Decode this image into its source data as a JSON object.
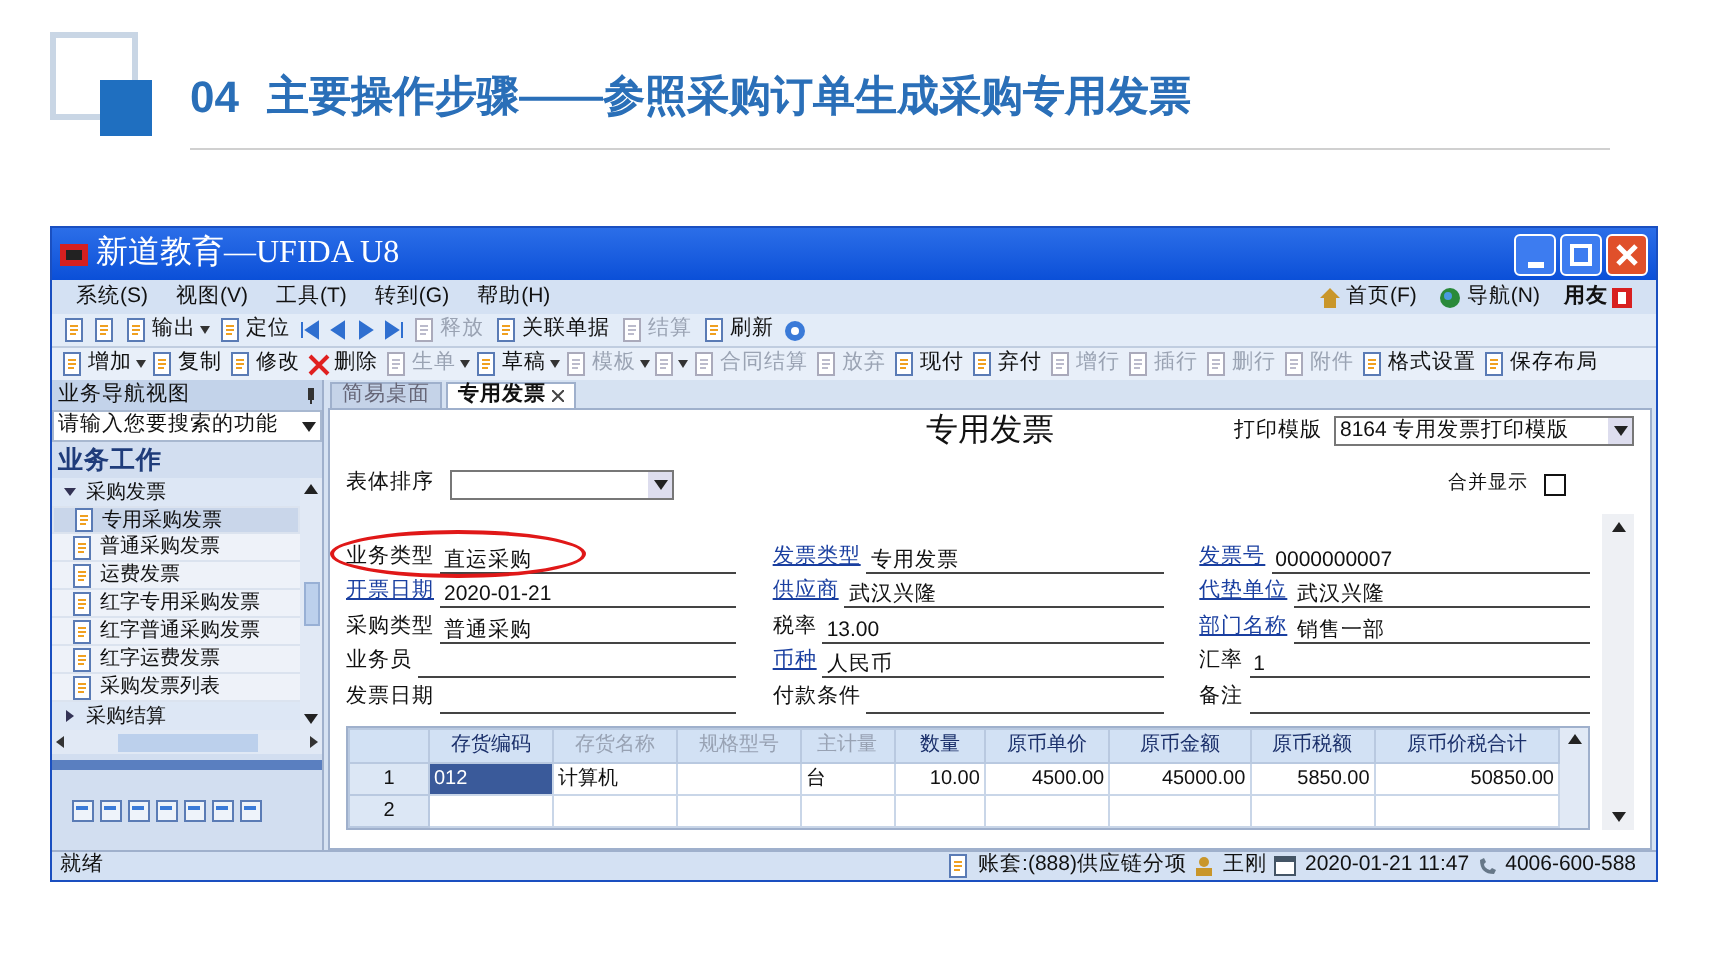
{
  "slide": {
    "number": "04",
    "title": "主要操作步骤——参照采购订单生成采购专用发票"
  },
  "window": {
    "title": "新道教育—UFIDA U8"
  },
  "menu": [
    "系统(S)",
    "视图(V)",
    "工具(T)",
    "转到(G)",
    "帮助(H)"
  ],
  "menu_right": [
    {
      "kind": "home",
      "label": "首页(F)"
    },
    {
      "kind": "globe",
      "label": "导航(N)"
    }
  ],
  "brand": "用友",
  "toolbar_1": [
    {
      "kind": "icon",
      "disabled": false
    },
    {
      "kind": "icon",
      "disabled": false
    },
    {
      "kind": "button",
      "label": "输出",
      "disabled": false,
      "menu": true
    },
    {
      "kind": "button",
      "label": "定位",
      "disabled": false,
      "menu": false
    },
    {
      "kind": "first",
      "disabled": false
    },
    {
      "kind": "prev",
      "disabled": false
    },
    {
      "kind": "next",
      "disabled": false
    },
    {
      "kind": "last",
      "disabled": false
    },
    {
      "kind": "button",
      "label": "释放",
      "disabled": true,
      "menu": false
    },
    {
      "kind": "button",
      "label": "关联单据",
      "disabled": false,
      "menu": false
    },
    {
      "kind": "button",
      "label": "结算",
      "disabled": true,
      "menu": false
    },
    {
      "kind": "button",
      "label": "刷新",
      "disabled": false,
      "menu": false
    },
    {
      "kind": "help",
      "disabled": false
    }
  ],
  "toolbar_2": [
    {
      "kind": "button",
      "label": "增加",
      "disabled": false,
      "menu": true
    },
    {
      "kind": "button",
      "label": "复制",
      "disabled": false,
      "menu": false
    },
    {
      "kind": "button",
      "label": "修改",
      "disabled": false,
      "menu": false
    },
    {
      "kind": "delete",
      "label": "删除",
      "disabled": false,
      "menu": false
    },
    {
      "kind": "button",
      "label": "生单",
      "disabled": true,
      "menu": true
    },
    {
      "kind": "button",
      "label": "草稿",
      "disabled": false,
      "menu": true
    },
    {
      "kind": "button",
      "label": "模板",
      "disabled": true,
      "menu": true
    },
    {
      "kind": "icon",
      "disabled": true,
      "menu": true
    },
    {
      "kind": "button",
      "label": "合同结算",
      "disabled": true,
      "menu": false
    },
    {
      "kind": "button",
      "label": "放弃",
      "disabled": true,
      "menu": false
    },
    {
      "kind": "button",
      "label": "现付",
      "disabled": false,
      "menu": false
    },
    {
      "kind": "button",
      "label": "弃付",
      "disabled": false,
      "menu": false
    },
    {
      "kind": "button",
      "label": "增行",
      "disabled": true,
      "menu": false
    },
    {
      "kind": "button",
      "label": "插行",
      "disabled": true,
      "menu": false
    },
    {
      "kind": "button",
      "label": "删行",
      "disabled": true,
      "menu": false
    },
    {
      "kind": "button",
      "label": "附件",
      "disabled": true,
      "menu": false
    },
    {
      "kind": "button",
      "label": "格式设置",
      "disabled": false,
      "menu": false
    },
    {
      "kind": "button",
      "label": "保存布局",
      "disabled": false,
      "menu": false
    }
  ],
  "sidebar": {
    "header": "业务导航视图",
    "search": {
      "value": "请输入您要搜索的功能"
    },
    "section": "业务工作",
    "tree": [
      {
        "label": "采购发票",
        "expanded": true,
        "children": [
          {
            "label": "专用采购发票",
            "selected": true
          },
          {
            "label": "普通采购发票",
            "selected": false
          },
          {
            "label": "运费发票",
            "selected": false
          },
          {
            "label": "红字专用采购发票",
            "selected": false
          },
          {
            "label": "红字普通采购发票",
            "selected": false
          },
          {
            "label": "红字运费发票",
            "selected": false
          },
          {
            "label": "采购发票列表",
            "selected": false
          }
        ]
      },
      {
        "label": "采购结算",
        "expanded": false
      }
    ]
  },
  "tabs": [
    {
      "label": "简易桌面",
      "selected": false,
      "closable": false
    },
    {
      "label": "专用发票",
      "selected": true,
      "closable": true
    }
  ],
  "form": {
    "title": "专用发票",
    "print_template": {
      "label": "打印模版",
      "value": "8164 专用发票打印模版"
    },
    "sort": {
      "label": "表体排序"
    },
    "merge": {
      "label": "合并显示",
      "checked": false
    },
    "fields": [
      {
        "label": "业务类型",
        "value": "直运采购",
        "required": false,
        "annotated": true
      },
      {
        "label": "发票类型",
        "value": "专用发票",
        "required": true,
        "annotated": false
      },
      {
        "label": "发票号",
        "value": "0000000007",
        "required": true,
        "annotated": false
      },
      {
        "label": "开票日期",
        "value": "2020-01-21",
        "required": true,
        "annotated": false
      },
      {
        "label": "供应商",
        "value": "武汉兴隆",
        "required": true,
        "annotated": false
      },
      {
        "label": "代垫单位",
        "value": "武汉兴隆",
        "required": true,
        "annotated": false
      },
      {
        "label": "采购类型",
        "value": "普通采购",
        "required": false,
        "annotated": false
      },
      {
        "label": "税率",
        "value": "13.00",
        "required": false,
        "annotated": false
      },
      {
        "label": "部门名称",
        "value": "销售一部",
        "required": true,
        "annotated": false
      },
      {
        "label": "业务员",
        "required": false,
        "annotated": false
      },
      {
        "label": "币种",
        "value": "人民币",
        "required": true,
        "annotated": false
      },
      {
        "label": "汇率",
        "value": "1",
        "required": false,
        "annotated": false
      },
      {
        "label": "发票日期",
        "required": false,
        "annotated": false
      },
      {
        "label": "付款条件",
        "required": false,
        "annotated": false
      },
      {
        "label": "备注",
        "required": false,
        "annotated": false
      }
    ]
  },
  "table": {
    "columns": [
      {
        "label": "存货编码",
        "disabled": false
      },
      {
        "label": "存货名称",
        "disabled": true
      },
      {
        "label": "规格型号",
        "disabled": true
      },
      {
        "label": "主计量",
        "disabled": true
      },
      {
        "label": "数量",
        "disabled": false
      },
      {
        "label": "原币单价",
        "disabled": false
      },
      {
        "label": "原币金额",
        "disabled": false
      },
      {
        "label": "原币税额",
        "disabled": false
      },
      {
        "label": "原币价税合计",
        "disabled": false
      }
    ],
    "rows": [
      {
        "number": "1",
        "cells": [
          "012",
          "计算机",
          "",
          "台",
          "10.00",
          "4500.00",
          "45000.00",
          "5850.00",
          "50850.00"
        ]
      },
      {
        "number": "2",
        "cells": [
          "",
          "",
          "",
          "",
          "",
          "",
          "",
          "",
          ""
        ]
      }
    ]
  },
  "status_bar": {
    "state": "就绪",
    "account": "账套:(888)供应链分项",
    "user": "王刚",
    "datetime": "2020-01-21  11:47",
    "phone": "4006-600-588"
  }
}
